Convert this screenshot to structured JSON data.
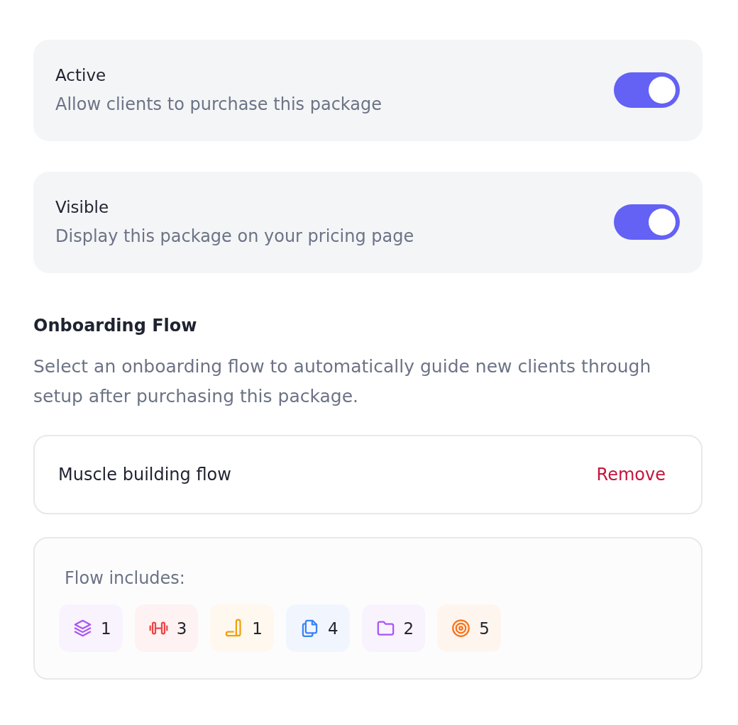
{
  "settings": [
    {
      "title": "Active",
      "description": "Allow clients to purchase this package",
      "on": true
    },
    {
      "title": "Visible",
      "description": "Display this package on your pricing page",
      "on": true
    }
  ],
  "onboarding": {
    "heading": "Onboarding Flow",
    "description": "Select an onboarding flow to automatically guide new clients through setup after purchasing this package.",
    "flow": {
      "name": "Muscle building flow",
      "action": "Remove"
    },
    "includes": {
      "label": "Flow includes:",
      "items": [
        {
          "kind": "layers",
          "count": "1",
          "color": "#a855f7"
        },
        {
          "kind": "dumbbell",
          "count": "3",
          "color": "#ef4444"
        },
        {
          "kind": "mat",
          "count": "1",
          "color": "#f59e0b"
        },
        {
          "kind": "files",
          "count": "4",
          "color": "#3b82f6"
        },
        {
          "kind": "folder",
          "count": "2",
          "color": "#a855f7"
        },
        {
          "kind": "target",
          "count": "5",
          "color": "#f97316"
        }
      ]
    }
  }
}
